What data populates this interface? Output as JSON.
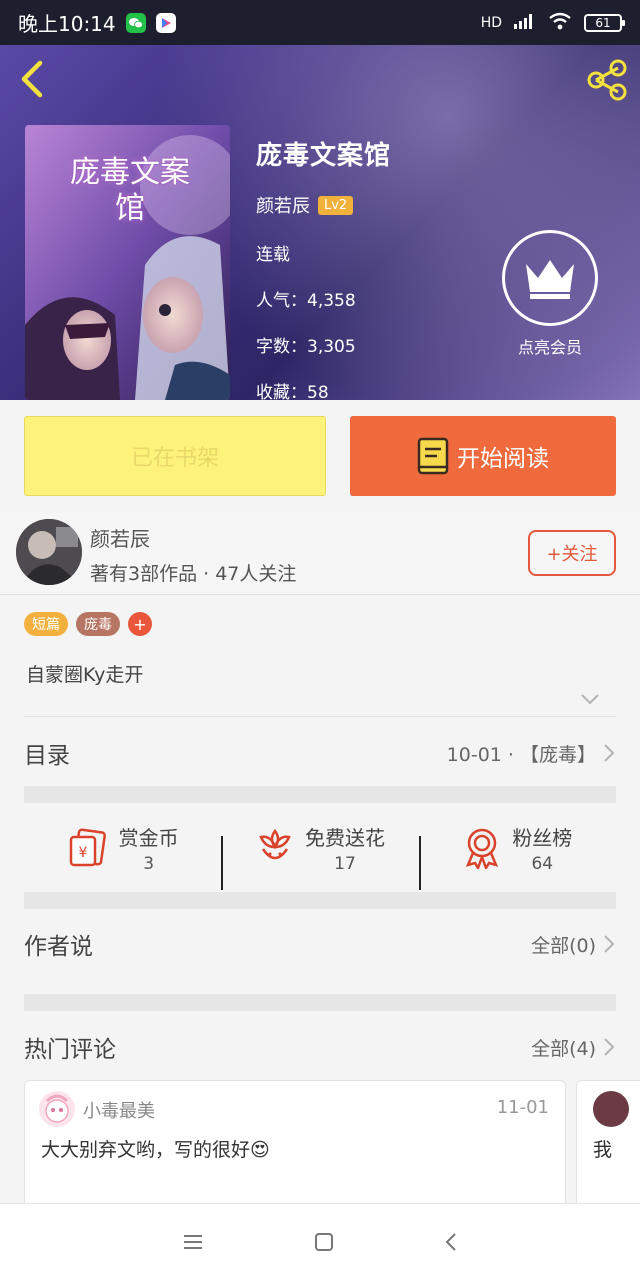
{
  "status_bar": {
    "time": "晚上10:14",
    "network": "HD",
    "battery": "61"
  },
  "book": {
    "title": "庞毒文案馆",
    "cover_title": "庞毒文案馆",
    "author": "颜若辰",
    "level": "Lv2",
    "status": "连载",
    "popularity": "人气：4,358",
    "word_count": "字数：3,305",
    "favorites": "收藏：58",
    "vip_label": "点亮会员"
  },
  "actions": {
    "shelf_label": "已在书架",
    "read_label": "开始阅读"
  },
  "author_row": {
    "name": "颜若辰",
    "stats": "著有3部作品 · 47人关注",
    "follow_label": "+关注"
  },
  "tags": [
    {
      "label": "短篇",
      "color": "#f2b13f"
    },
    {
      "label": "庞毒",
      "color": "#b77564"
    },
    {
      "label": "+",
      "color": "#e9563b"
    }
  ],
  "description": "自蒙圈Ky走开",
  "catalog": {
    "title": "目录",
    "latest": "10-01 · 【庞毒】"
  },
  "stats": [
    {
      "label": "赏金币",
      "value": "3",
      "icon": "reward-envelope-icon"
    },
    {
      "label": "免费送花",
      "value": "17",
      "icon": "flower-icon"
    },
    {
      "label": "粉丝榜",
      "value": "64",
      "icon": "medal-icon"
    }
  ],
  "author_says": {
    "title": "作者说",
    "link": "全部(0)"
  },
  "hot_comments": {
    "title": "热门评论",
    "link": "全部(4)"
  },
  "comments": [
    {
      "user": "小毒最美",
      "date": "11-01",
      "text": "大大别弃文哟，写的很好😍"
    },
    {
      "user": "",
      "date": "",
      "text": "我"
    }
  ],
  "colors": {
    "accent": "#ef6a3c",
    "shelf": "#fdf37a",
    "icon_red": "#d9432b"
  }
}
